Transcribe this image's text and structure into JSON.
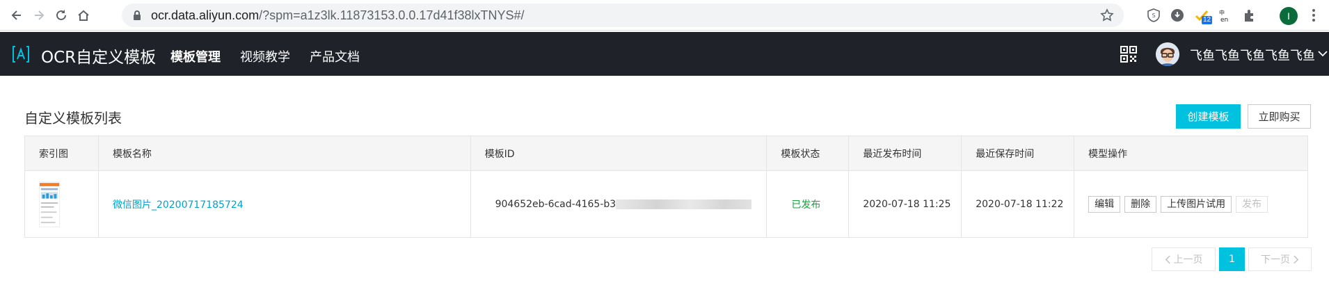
{
  "browser": {
    "url_host": "ocr.data.aliyun.com",
    "url_rest": "/?spm=a1z3lk.11873153.0.0.17d41f38lxTNYS#/",
    "extension_badge": "12",
    "profile_initial": "I",
    "icons": [
      "back-icon",
      "forward-icon",
      "reload-icon",
      "home-icon",
      "lock-icon",
      "star-icon",
      "extension-icon",
      "puzzle-icon",
      "menu-icon"
    ]
  },
  "header": {
    "brand": "OCR自定义模板",
    "nav": [
      {
        "label": "模板管理",
        "active": true
      },
      {
        "label": "视频教学",
        "active": false
      },
      {
        "label": "产品文档",
        "active": false
      }
    ],
    "username": "飞鱼飞鱼飞鱼飞鱼飞鱼"
  },
  "page": {
    "title": "自定义模板列表",
    "create_button": "创建模板",
    "buy_button": "立即购买"
  },
  "table": {
    "columns": [
      "索引图",
      "模板名称",
      "模板ID",
      "模板状态",
      "最近发布时间",
      "最近保存时间",
      "模型操作"
    ],
    "rows": [
      {
        "name": "微信图片_20200717185724",
        "id_visible": "904652eb-6cad-4165-b3",
        "status": "已发布",
        "published": "2020-07-18 11:25",
        "saved": "2020-07-18 11:22",
        "actions": {
          "edit": "编辑",
          "delete": "删除",
          "upload_try": "上传图片试用",
          "publish": "发布"
        }
      }
    ]
  },
  "pagination": {
    "prev": "上一页",
    "current": "1",
    "next": "下一页"
  },
  "colors": {
    "accent": "#00c1de",
    "header_bg": "#1f2228",
    "link": "#00a2c9",
    "status_ok": "#1e9e3e"
  }
}
